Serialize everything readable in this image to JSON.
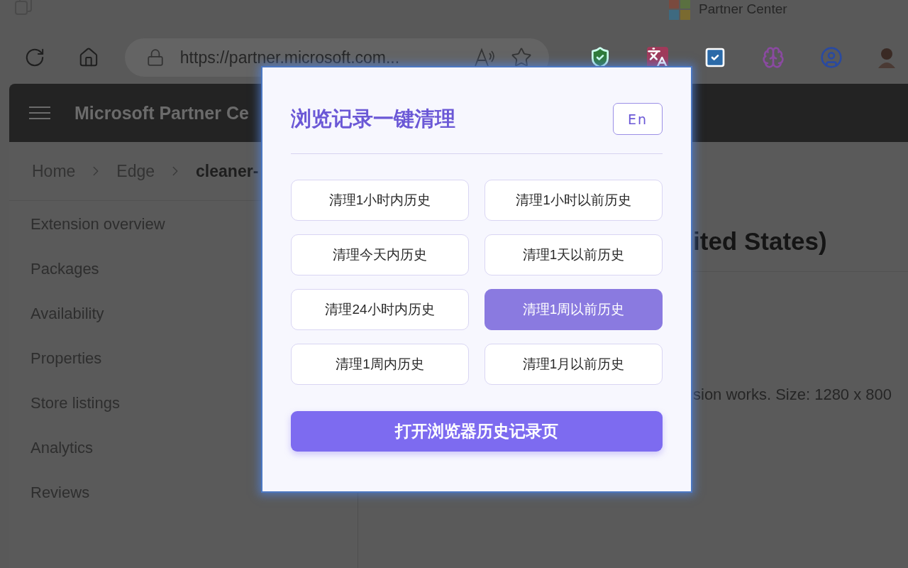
{
  "browser": {
    "tab_title": "Partner Center",
    "url": "https://partner.microsoft.com..."
  },
  "page": {
    "header_title": "Microsoft Partner Ce",
    "breadcrumbs": [
      {
        "label": "Home",
        "current": false
      },
      {
        "label": "Edge",
        "current": false
      },
      {
        "label": "cleaner-",
        "current": true
      }
    ],
    "sidebar": {
      "items": [
        "Extension overview",
        "Packages",
        "Availability",
        "Properties",
        "Store listings",
        "Analytics",
        "Reviews"
      ]
    },
    "content": {
      "title": "ited States)",
      "text": "sion works. Size: 1280 x 800"
    }
  },
  "popup": {
    "title": "浏览记录一键清理",
    "language_button": "En",
    "options": [
      {
        "label": "清理1小时内历史",
        "selected": false
      },
      {
        "label": "清理1小时以前历史",
        "selected": false
      },
      {
        "label": "清理今天内历史",
        "selected": false
      },
      {
        "label": "清理1天以前历史",
        "selected": false
      },
      {
        "label": "清理24小时内历史",
        "selected": false
      },
      {
        "label": "清理1周以前历史",
        "selected": true
      },
      {
        "label": "清理1周内历史",
        "selected": false
      },
      {
        "label": "清理1月以前历史",
        "selected": false
      }
    ],
    "open_history_button": "打开浏览器历史记录页"
  }
}
